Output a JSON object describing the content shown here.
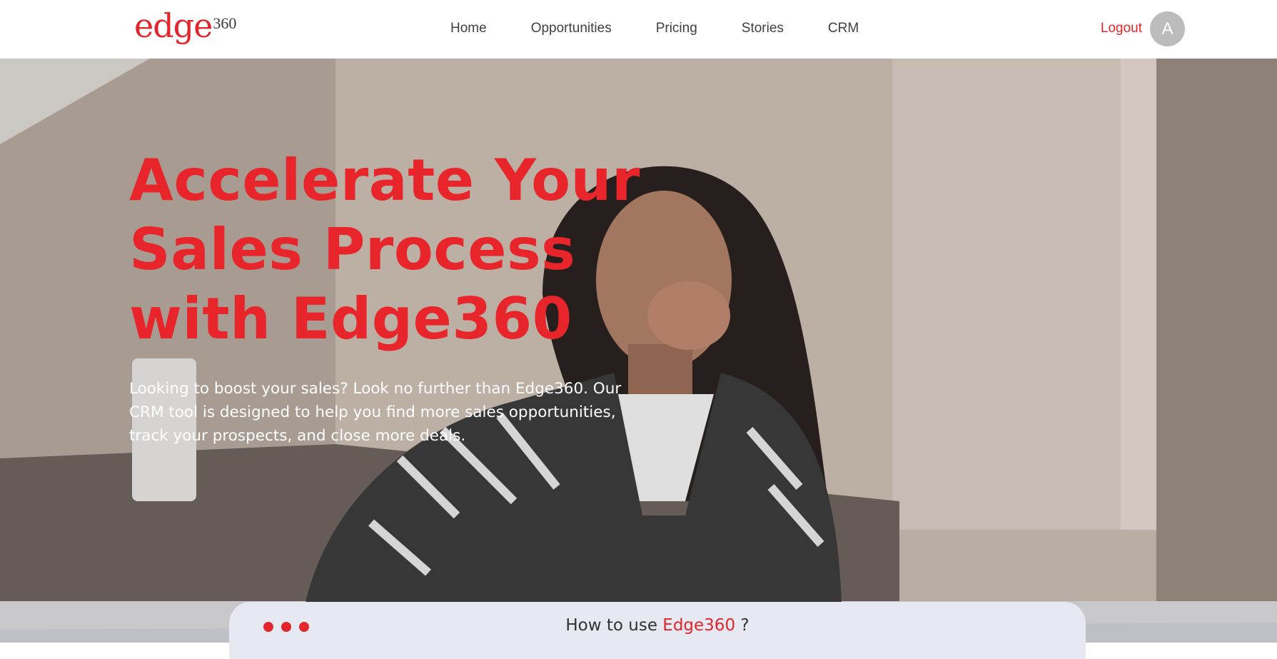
{
  "header": {
    "logo_text": "edge",
    "logo_suffix": "360",
    "nav": [
      "Home",
      "Opportunities",
      "Pricing",
      "Stories",
      "CRM"
    ],
    "logout_label": "Logout",
    "avatar_initial": "A"
  },
  "hero": {
    "title": "Accelerate Your\nSales Process\nwith Edge360",
    "description": "Looking to boost your sales? Look no further than Edge360. Our CRM tool is designed to help you find more sales opportunities, track your prospects, and close more deals."
  },
  "howto": {
    "prefix": "How to use ",
    "brand": "Edge360",
    "suffix": " ?"
  },
  "colors": {
    "accent": "#e3262b",
    "panel": "#e6e8f2",
    "avatar": "#bcbcbc"
  }
}
